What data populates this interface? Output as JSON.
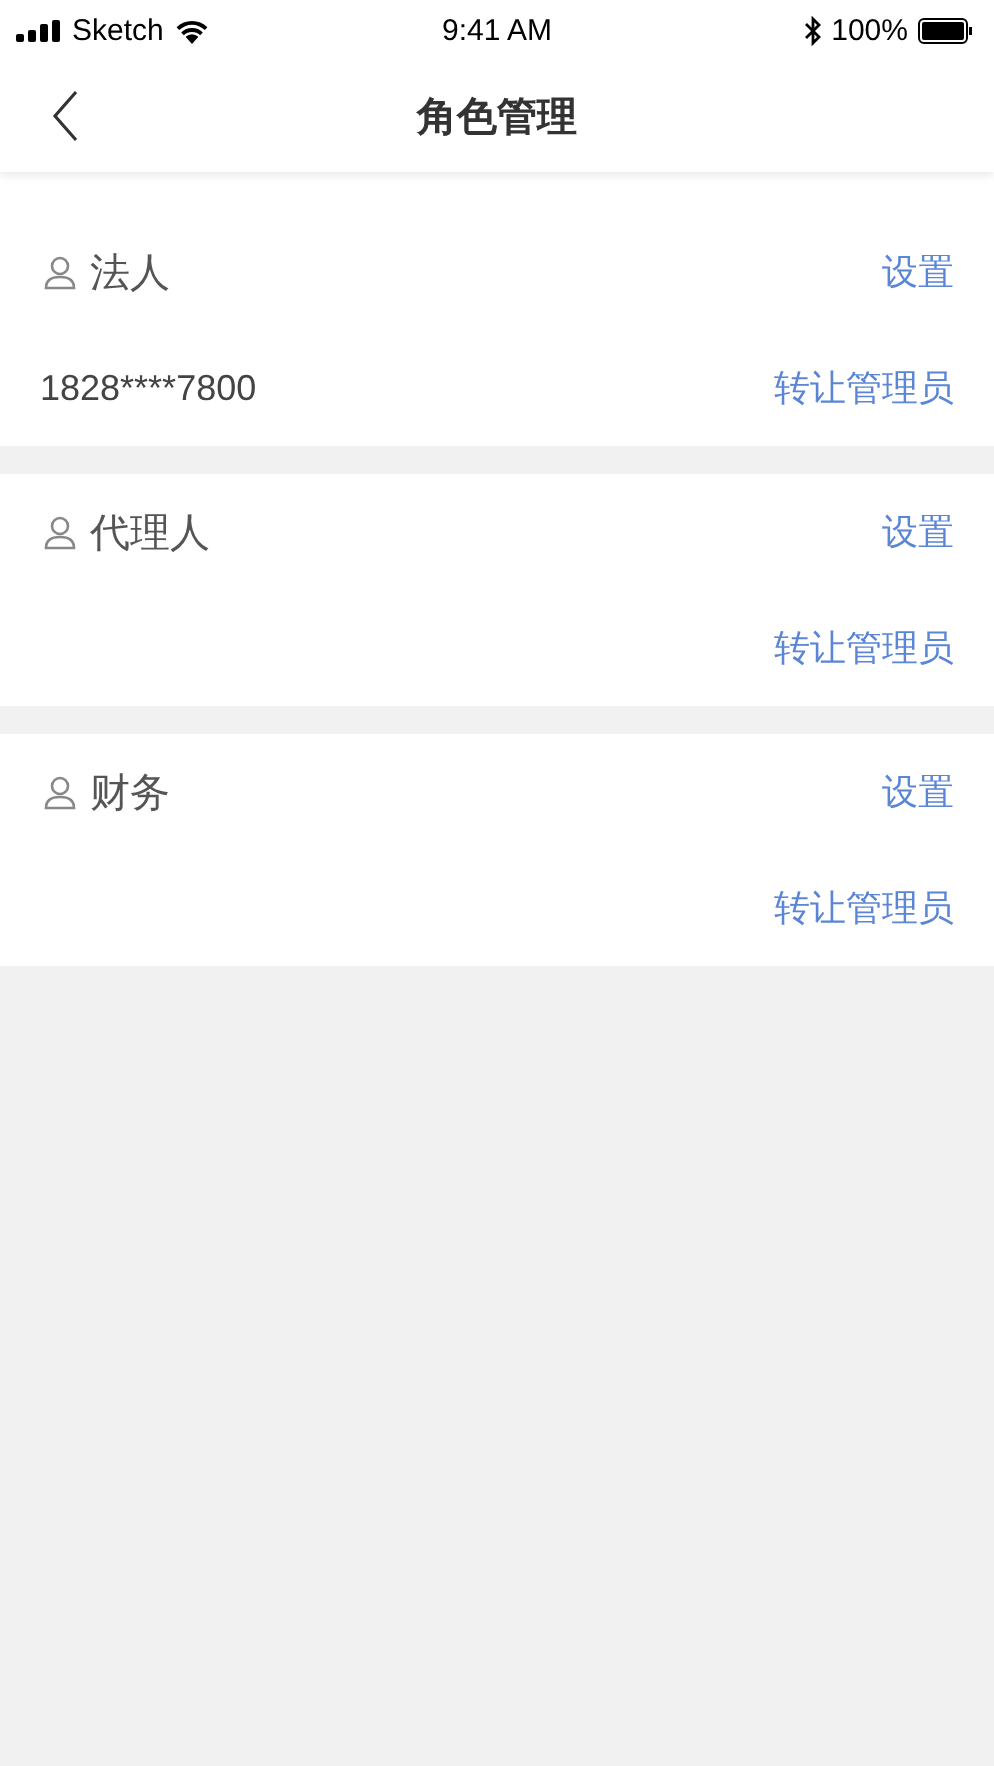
{
  "status_bar": {
    "carrier": "Sketch",
    "time": "9:41 AM",
    "battery": "100%"
  },
  "nav_bar": {
    "title": "角色管理"
  },
  "roles": [
    {
      "name": "法人",
      "setting": "设置",
      "phone": "1828****7800",
      "transfer": "转让管理员"
    },
    {
      "name": "代理人",
      "setting": "设置",
      "transfer": "转让管理员"
    },
    {
      "name": "财务",
      "setting": "设置",
      "transfer": "转让管理员"
    }
  ]
}
